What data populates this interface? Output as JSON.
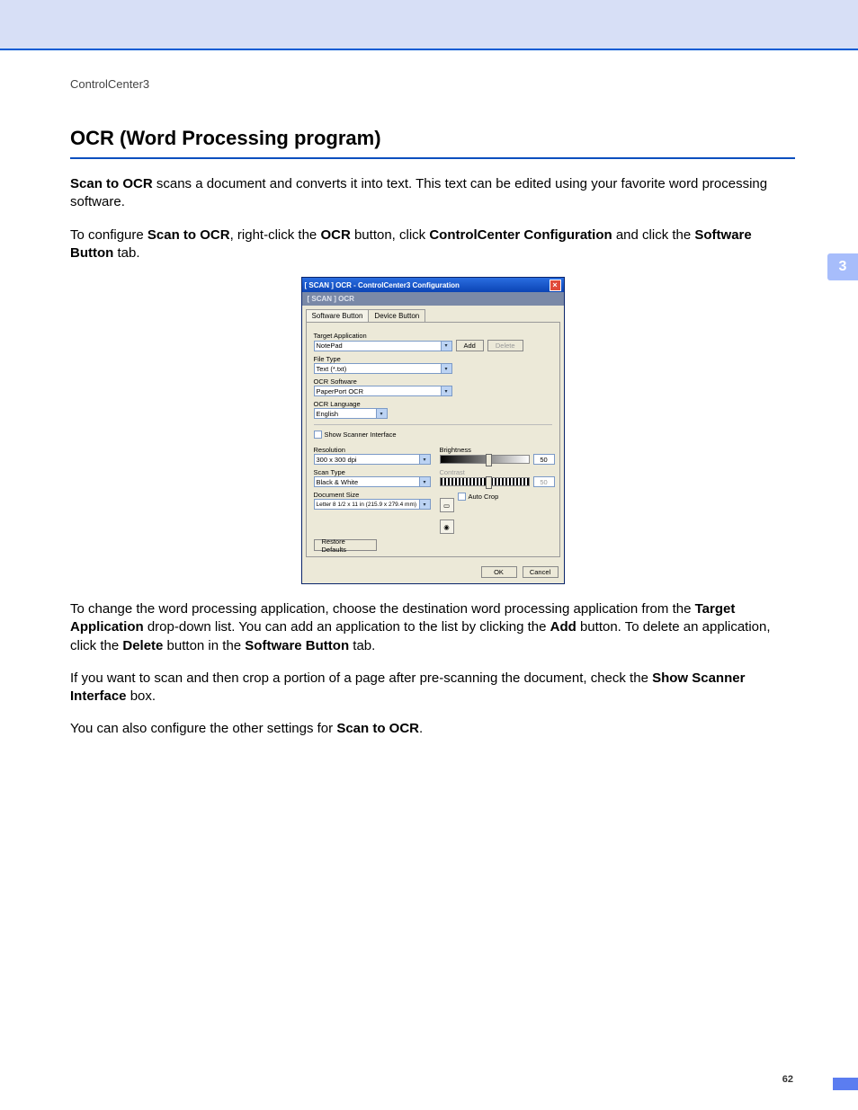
{
  "breadcrumb": "ControlCenter3",
  "heading": "OCR (Word Processing program)",
  "para1": {
    "lead_bold": "Scan to OCR",
    "rest": " scans a document and converts it into text. This text can be edited using your favorite word processing software."
  },
  "para2": {
    "p1": "To configure ",
    "b1": "Scan to OCR",
    "p2": ", right-click the ",
    "b2": "OCR",
    "p3": " button, click ",
    "b3": "ControlCenter Configuration",
    "p4": " and click the ",
    "b4": "Software Button",
    "p5": " tab."
  },
  "para3": {
    "p1": "To change the word processing application, choose the destination word processing application from the ",
    "b1": "Target Application",
    "p2": " drop-down list. You can add an application to the list by clicking the ",
    "b2": "Add",
    "p3": " button. To delete an application, click the ",
    "b3": "Delete",
    "p4": " button in the ",
    "b4": "Software Button",
    "p5": " tab."
  },
  "para4": {
    "p1": "If you want to scan and then crop a portion of a page after pre-scanning the document, check the ",
    "b1": "Show Scanner Interface",
    "p2": " box."
  },
  "para5": {
    "p1": "You can also configure the other settings for ",
    "b1": "Scan to OCR",
    "p2": "."
  },
  "dialog": {
    "title": "[ SCAN ]  OCR - ControlCenter3 Configuration",
    "subtitle": "[ SCAN ]  OCR",
    "tabs": {
      "active": "Software Button",
      "inactive": "Device Button"
    },
    "labels": {
      "target_app": "Target Application",
      "file_type": "File Type",
      "ocr_software": "OCR Software",
      "ocr_language": "OCR Language",
      "show_scanner": "Show Scanner Interface",
      "resolution": "Resolution",
      "scan_type": "Scan Type",
      "doc_size": "Document Size",
      "brightness": "Brightness",
      "contrast": "Contrast",
      "auto_crop": "Auto Crop",
      "restore": "Restore Defaults",
      "ok": "OK",
      "cancel": "Cancel",
      "add": "Add",
      "delete": "Delete"
    },
    "values": {
      "target_app": "NotePad",
      "file_type": "Text (*.txt)",
      "ocr_software": "PaperPort OCR",
      "ocr_language": "English",
      "resolution": "300 x 300 dpi",
      "scan_type": "Black & White",
      "doc_size": "Letter 8 1/2 x 11 in (215.9 x 279.4 mm)",
      "brightness": "50",
      "contrast": "50"
    }
  },
  "side_tab": "3",
  "page_number": "62"
}
